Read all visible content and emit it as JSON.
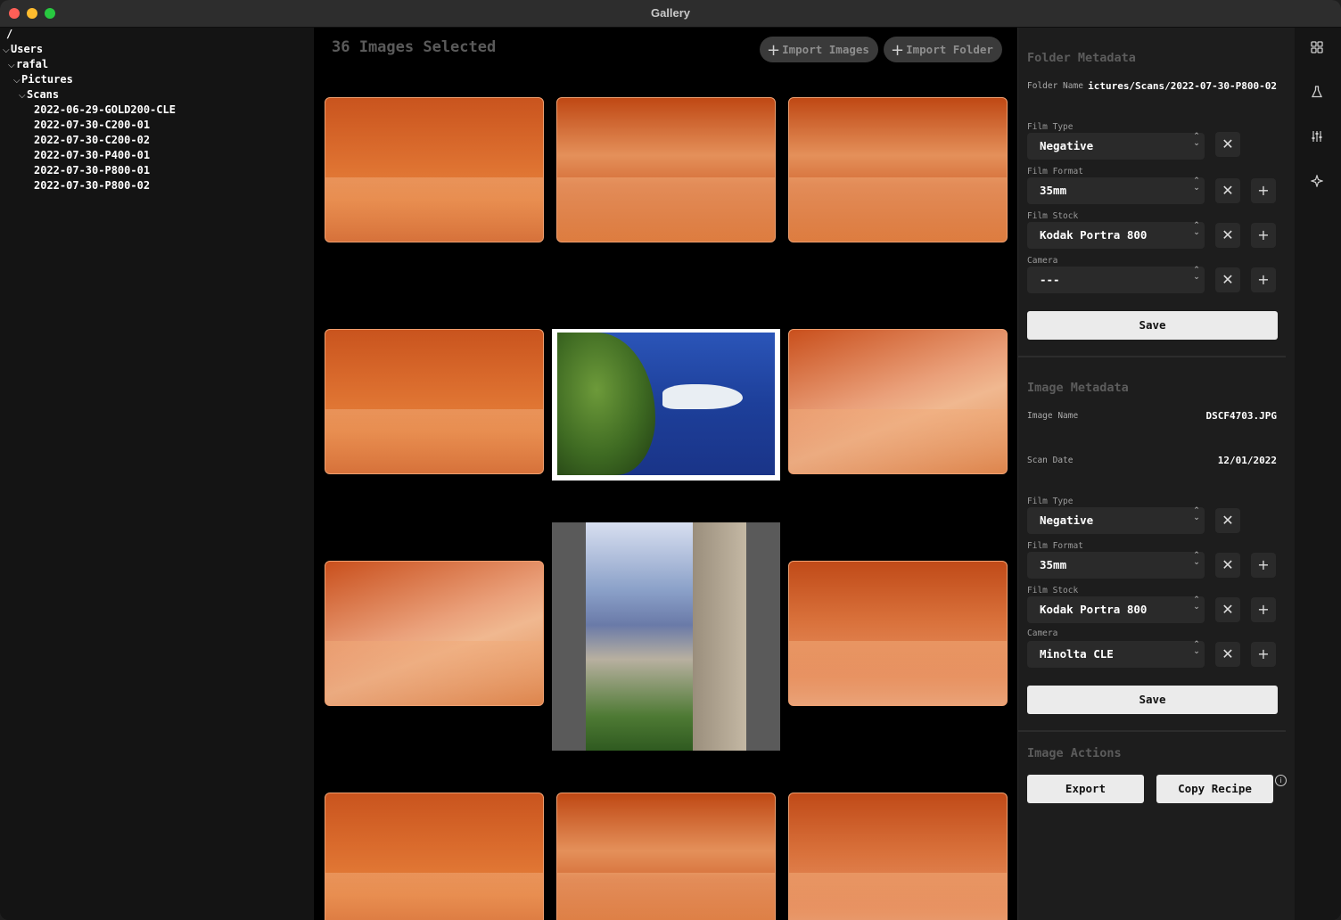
{
  "window": {
    "title": "Gallery"
  },
  "sidebar": {
    "root": "/",
    "tree": [
      {
        "label": "Users",
        "expanded": true
      },
      {
        "label": "rafal",
        "expanded": true
      },
      {
        "label": "Pictures",
        "expanded": true
      },
      {
        "label": "Scans",
        "expanded": true
      },
      {
        "label": "2022-06-29-GOLD200-CLE"
      },
      {
        "label": "2022-07-30-C200-01"
      },
      {
        "label": "2022-07-30-C200-02"
      },
      {
        "label": "2022-07-30-P400-01"
      },
      {
        "label": "2022-07-30-P800-01"
      },
      {
        "label": "2022-07-30-P800-02"
      }
    ]
  },
  "gallery": {
    "selection_label": "36 Images Selected",
    "import_images_label": "Import Images",
    "import_folder_label": "Import Folder"
  },
  "folder_metadata": {
    "title": "Folder Metadata",
    "folder_name_label": "Folder Name",
    "folder_name_value": "ictures/Scans/2022-07-30-P800-02",
    "film_type_label": "Film Type",
    "film_type_value": "Negative",
    "film_format_label": "Film Format",
    "film_format_value": "35mm",
    "film_stock_label": "Film Stock",
    "film_stock_value": "Kodak Portra 800",
    "camera_label": "Camera",
    "camera_value": "---",
    "save_label": "Save"
  },
  "image_metadata": {
    "title": "Image Metadata",
    "image_name_label": "Image Name",
    "image_name_value": "DSCF4703.JPG",
    "scan_date_label": "Scan Date",
    "scan_date_value": "12/01/2022",
    "film_type_label": "Film Type",
    "film_type_value": "Negative",
    "film_format_label": "Film Format",
    "film_format_value": "35mm",
    "film_stock_label": "Film Stock",
    "film_stock_value": "Kodak Portra 800",
    "camera_label": "Camera",
    "camera_value": "Minolta CLE",
    "save_label": "Save"
  },
  "image_actions": {
    "title": "Image Actions",
    "export_label": "Export",
    "copy_recipe_label": "Copy Recipe"
  },
  "toolbar": {
    "icons": [
      "grid-icon",
      "flask-icon",
      "sliders-icon",
      "magic-icon"
    ]
  }
}
